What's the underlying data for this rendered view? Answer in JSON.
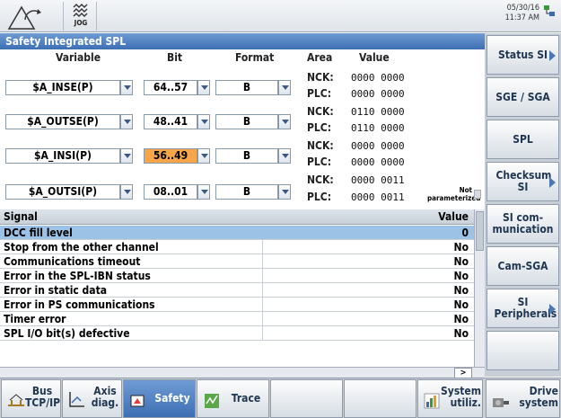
{
  "header": {
    "mode_label": "JOG",
    "date": "05/30/16",
    "time": "11:37 AM"
  },
  "panel": {
    "title": "Safety Integrated SPL",
    "headers": {
      "variable": "Variable",
      "bit": "Bit",
      "format": "Format",
      "area": "Area",
      "value": "Value"
    },
    "variables": [
      {
        "name": "$A_INSE(P)",
        "bit": "64..57",
        "format": "B",
        "nck": "0000 0000",
        "plc": "0000 0000",
        "highlight": false
      },
      {
        "name": "$A_OUTSE(P)",
        "bit": "48..41",
        "format": "B",
        "nck": "0110 0000",
        "plc": "0110 0000",
        "highlight": false
      },
      {
        "name": "$A_INSI(P)",
        "bit": "56..49",
        "format": "B",
        "nck": "0000 0000",
        "plc": "0000 0000",
        "highlight": true
      },
      {
        "name": "$A_OUTSI(P)",
        "bit": "08..01",
        "format": "B",
        "nck": "0000 0011",
        "plc": "0000 0011",
        "highlight": false
      }
    ],
    "area_nck": "NCK:",
    "area_plc": "PLC:",
    "not_parameterized": "Not parameterized"
  },
  "signals": {
    "header_signal": "Signal",
    "header_value": "Value",
    "rows": [
      {
        "name": "DCC fill level",
        "value": "0",
        "selected": true
      },
      {
        "name": "Stop from the other channel",
        "value": "No"
      },
      {
        "name": "Communications timeout",
        "value": "No"
      },
      {
        "name": "Error in the SPL-IBN status",
        "value": "No"
      },
      {
        "name": "Error in static data",
        "value": "No"
      },
      {
        "name": "Error in PS communications",
        "value": "No"
      },
      {
        "name": "Timer error",
        "value": "No"
      },
      {
        "name": "SPL I/O bit(s) defective",
        "value": "No"
      }
    ],
    "hscroll_label": ">"
  },
  "right_softkeys": [
    "Status SI",
    "SGE / SGA",
    "SPL",
    "Checksum SI",
    "SI com-munication",
    "Cam-SGA",
    "SI Peripherals",
    ""
  ],
  "bottom_softkeys": {
    "bus": "Bus TCP/IP",
    "axis": "Axis diag.",
    "safety": "Safety",
    "trace": "Trace",
    "system": "System utiliz.",
    "drive": "Drive system"
  },
  "colors": {
    "title_bar": "#3d6fb4",
    "highlight": "#f6a54a",
    "selected_row": "#9cc3e6"
  }
}
